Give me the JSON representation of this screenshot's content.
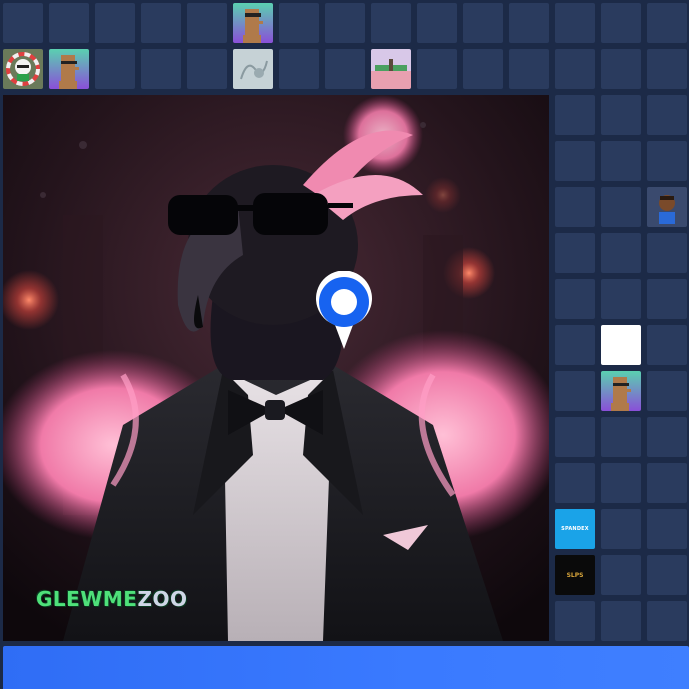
{
  "featured": {
    "watermark_part1": "GLEWME",
    "watermark_part2": "ZOO"
  },
  "tiles": {
    "brand_blue": "SPANDEX",
    "brand_black": "SLPS"
  },
  "pin": {
    "color": "#1763f0"
  },
  "colors": {
    "accent": "#3a7aff",
    "tile": "#2a3b5e",
    "background": "#1c2a47"
  }
}
